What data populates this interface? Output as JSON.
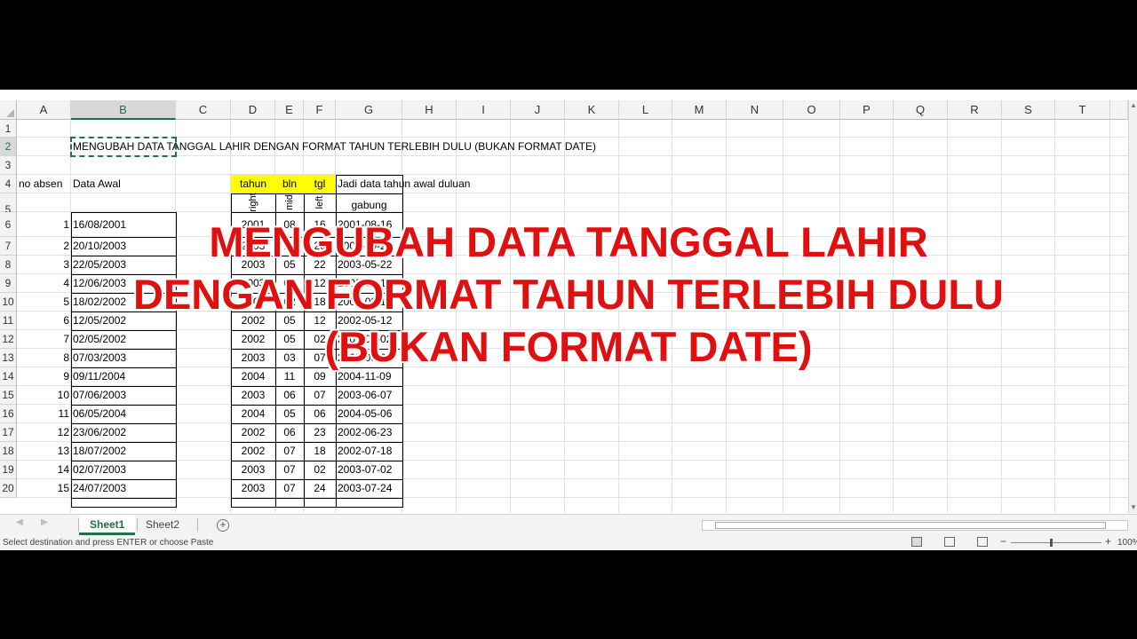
{
  "columns": [
    "A",
    "B",
    "C",
    "D",
    "E",
    "F",
    "G",
    "H",
    "I",
    "J",
    "K",
    "L",
    "M",
    "N",
    "O",
    "P",
    "Q",
    "R",
    "S",
    "T"
  ],
  "rows": [
    "1",
    "2",
    "3",
    "4",
    "5",
    "6",
    "7",
    "8",
    "9",
    "10",
    "11",
    "12",
    "13",
    "14",
    "15",
    "16",
    "17",
    "18",
    "19",
    "20"
  ],
  "heading_text": "MENGUBAH DATA TANGGAL LAHIR DENGAN FORMAT TAHUN TERLEBIH DULU (BUKAN FORMAT DATE)",
  "header_row": {
    "no_absen": "no absen",
    "data_awal": "Data Awal",
    "tahun": "tahun",
    "bln": "bln",
    "tgl": "tgl",
    "note": "Jadi data tahun awal duluan"
  },
  "func_row": {
    "right": "right",
    "mid": "mid",
    "left": "left",
    "gabung": "gabung"
  },
  "table_rows": [
    {
      "no": "1",
      "awal": "16/08/2001",
      "tahun": "2001",
      "bln": "08",
      "tgl": "16",
      "gabung": "2001-08-16"
    },
    {
      "no": "2",
      "awal": "20/10/2003",
      "tahun": "2003",
      "bln": "10",
      "tgl": "20",
      "gabung": "2003-10-20"
    },
    {
      "no": "3",
      "awal": "22/05/2003",
      "tahun": "2003",
      "bln": "05",
      "tgl": "22",
      "gabung": "2003-05-22"
    },
    {
      "no": "4",
      "awal": "12/06/2003",
      "tahun": "2003",
      "bln": "06",
      "tgl": "12",
      "gabung": "2003-06-12"
    },
    {
      "no": "5",
      "awal": "18/02/2002",
      "tahun": "2002",
      "bln": "02",
      "tgl": "18",
      "gabung": "2002-02-18"
    },
    {
      "no": "6",
      "awal": "12/05/2002",
      "tahun": "2002",
      "bln": "05",
      "tgl": "12",
      "gabung": "2002-05-12"
    },
    {
      "no": "7",
      "awal": "02/05/2002",
      "tahun": "2002",
      "bln": "05",
      "tgl": "02",
      "gabung": "2002-05-02"
    },
    {
      "no": "8",
      "awal": "07/03/2003",
      "tahun": "2003",
      "bln": "03",
      "tgl": "07",
      "gabung": "2003-03-07"
    },
    {
      "no": "9",
      "awal": "09/11/2004",
      "tahun": "2004",
      "bln": "11",
      "tgl": "09",
      "gabung": "2004-11-09"
    },
    {
      "no": "10",
      "awal": "07/06/2003",
      "tahun": "2003",
      "bln": "06",
      "tgl": "07",
      "gabung": "2003-06-07"
    },
    {
      "no": "11",
      "awal": "06/05/2004",
      "tahun": "2004",
      "bln": "05",
      "tgl": "06",
      "gabung": "2004-05-06"
    },
    {
      "no": "12",
      "awal": "23/06/2002",
      "tahun": "2002",
      "bln": "06",
      "tgl": "23",
      "gabung": "2002-06-23"
    },
    {
      "no": "13",
      "awal": "18/07/2002",
      "tahun": "2002",
      "bln": "07",
      "tgl": "18",
      "gabung": "2002-07-18"
    },
    {
      "no": "14",
      "awal": "02/07/2003",
      "tahun": "2003",
      "bln": "07",
      "tgl": "02",
      "gabung": "2003-07-02"
    },
    {
      "no": "15",
      "awal": "24/07/2003",
      "tahun": "2003",
      "bln": "07",
      "tgl": "24",
      "gabung": "2003-07-24"
    }
  ],
  "overlay_title": [
    "MENGUBAH DATA TANGGAL LAHIR",
    "DENGAN FORMAT TAHUN TERLEBIH DULU",
    "(BUKAN FORMAT DATE)"
  ],
  "tabs": {
    "sheet1": "Sheet1",
    "sheet2": "Sheet2",
    "add": "+"
  },
  "status": {
    "message": "Select destination and press ENTER or choose Paste",
    "zoom": "100%"
  },
  "colors": {
    "accent": "#217346",
    "highlight": "#ffff00",
    "overlay_text": "#e01010"
  }
}
